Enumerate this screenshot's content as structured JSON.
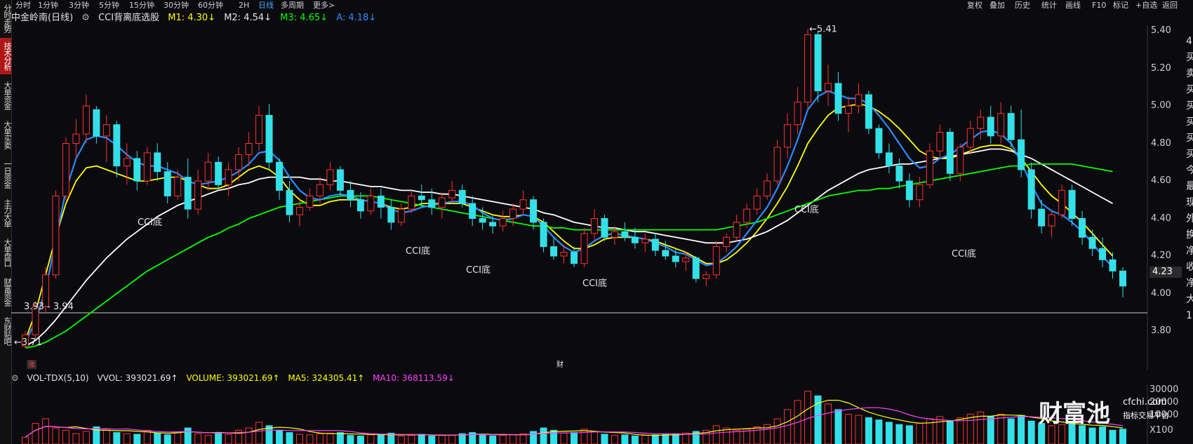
{
  "toolbar": {
    "periods": [
      "分时",
      "1分钟",
      "3分钟",
      "5分钟",
      "15分钟",
      "30分钟",
      "60分钟",
      "2H",
      "日线",
      "多周期",
      "更多>"
    ],
    "active_period": "日线",
    "right_tools": [
      "复权",
      "叠加",
      "历史",
      "统计",
      "画线",
      "F10",
      "标记",
      "+自选",
      "返回"
    ]
  },
  "left_tabs": [
    "分时走势",
    "技术分析",
    "大单资金",
    "大单买卖",
    "一日资金",
    "主力大单",
    "大单盘口",
    "财富资金",
    "东财贴吧"
  ],
  "active_left_tab": "技术分析",
  "title": {
    "stock": "中金岭南(日线)",
    "indicator": "CCI背离底选股",
    "m1": "M1: 4.30↓",
    "m2": "M2: 4.54↓",
    "m3": "M3: 4.65↓",
    "a": "A: 4.18↓"
  },
  "indicator_colors": {
    "m1": "#ffff00",
    "m2": "#ffffff",
    "m3": "#00ff00",
    "a": "#2a8cff",
    "up": "#ff3030",
    "down": "#33e0e8"
  },
  "price_axis": [
    "5.40",
    "5.20",
    "5.00",
    "4.80",
    "4.60",
    "4.40",
    "4.20",
    "4.00",
    "3.80"
  ],
  "current_price_label": "4.23",
  "annotations": {
    "high": "5.41",
    "low": "3.71",
    "support_range": "3.93 - 3.94",
    "cci_labels": [
      "CCI底",
      "CCI底",
      "CCI底",
      "CCI底",
      "CCI底",
      "CCI底"
    ],
    "zhang_badge": "涨",
    "cai_badge": "财"
  },
  "volume_header": {
    "name": "VOL-TDX(5,10)",
    "vvol": "VVOL: 393021.69↑",
    "volume": "VOLUME: 393021.69↑",
    "ma5": "MA5: 324305.41↑",
    "ma10": "MA10: 368113.59↓"
  },
  "volume_axis": [
    "30000",
    "20000",
    "10000",
    "X100"
  ],
  "right_side_text": [
    "4",
    "买",
    "卖",
    "买",
    "买",
    "买",
    "买",
    "买",
    "今",
    "最",
    "现",
    "外",
    "换",
    "净",
    "收",
    "净",
    "大",
    "1("
  ],
  "watermark": {
    "brand": "财富池",
    "site": "cfchi.com",
    "tagline": "指标交易平台"
  },
  "chart_data": {
    "type": "candlestick",
    "title": "中金岭南(日线)",
    "y_range": [
      3.7,
      5.45
    ],
    "high": 5.41,
    "low": 3.71,
    "last_close": 4.04,
    "ohlc": [
      [
        3.72,
        3.8,
        3.71,
        3.78
      ],
      [
        3.78,
        3.96,
        3.76,
        3.93
      ],
      [
        3.93,
        4.14,
        3.9,
        4.1
      ],
      [
        4.1,
        4.55,
        4.08,
        4.52
      ],
      [
        4.52,
        4.83,
        4.5,
        4.8
      ],
      [
        4.8,
        4.93,
        4.72,
        4.85
      ],
      [
        4.85,
        5.06,
        4.8,
        5.0
      ],
      [
        4.98,
        5.0,
        4.8,
        4.84
      ],
      [
        4.84,
        4.95,
        4.7,
        4.9
      ],
      [
        4.9,
        4.92,
        4.62,
        4.68
      ],
      [
        4.68,
        4.8,
        4.58,
        4.72
      ],
      [
        4.72,
        4.76,
        4.55,
        4.6
      ],
      [
        4.6,
        4.78,
        4.58,
        4.75
      ],
      [
        4.75,
        4.8,
        4.6,
        4.65
      ],
      [
        4.65,
        4.7,
        4.48,
        4.52
      ],
      [
        4.52,
        4.66,
        4.5,
        4.62
      ],
      [
        4.62,
        4.72,
        4.4,
        4.45
      ],
      [
        4.45,
        4.66,
        4.42,
        4.6
      ],
      [
        4.6,
        4.75,
        4.55,
        4.7
      ],
      [
        4.7,
        4.73,
        4.55,
        4.58
      ],
      [
        4.58,
        4.7,
        4.52,
        4.66
      ],
      [
        4.66,
        4.78,
        4.6,
        4.74
      ],
      [
        4.74,
        4.86,
        4.68,
        4.8
      ],
      [
        4.8,
        5.0,
        4.76,
        4.95
      ],
      [
        4.95,
        5.01,
        4.66,
        4.7
      ],
      [
        4.7,
        4.72,
        4.5,
        4.55
      ],
      [
        4.55,
        4.6,
        4.38,
        4.42
      ],
      [
        4.42,
        4.5,
        4.36,
        4.46
      ],
      [
        4.46,
        4.56,
        4.44,
        4.52
      ],
      [
        4.52,
        4.62,
        4.48,
        4.58
      ],
      [
        4.58,
        4.7,
        4.55,
        4.66
      ],
      [
        4.66,
        4.68,
        4.52,
        4.55
      ],
      [
        4.55,
        4.6,
        4.46,
        4.5
      ],
      [
        4.5,
        4.54,
        4.4,
        4.44
      ],
      [
        4.44,
        4.56,
        4.42,
        4.52
      ],
      [
        4.52,
        4.56,
        4.4,
        4.46
      ],
      [
        4.46,
        4.5,
        4.34,
        4.38
      ],
      [
        4.38,
        4.48,
        4.36,
        4.45
      ],
      [
        4.45,
        4.55,
        4.43,
        4.52
      ],
      [
        4.52,
        4.58,
        4.46,
        4.5
      ],
      [
        4.5,
        4.56,
        4.42,
        4.46
      ],
      [
        4.46,
        4.54,
        4.4,
        4.51
      ],
      [
        4.51,
        4.6,
        4.48,
        4.55
      ],
      [
        4.55,
        4.58,
        4.46,
        4.48
      ],
      [
        4.48,
        4.52,
        4.36,
        4.4
      ],
      [
        4.4,
        4.46,
        4.34,
        4.38
      ],
      [
        4.38,
        4.42,
        4.32,
        4.36
      ],
      [
        4.36,
        4.44,
        4.33,
        4.4
      ],
      [
        4.4,
        4.48,
        4.36,
        4.45
      ],
      [
        4.45,
        4.55,
        4.42,
        4.5
      ],
      [
        4.5,
        4.52,
        4.34,
        4.38
      ],
      [
        4.38,
        4.4,
        4.22,
        4.25
      ],
      [
        4.25,
        4.3,
        4.18,
        4.2
      ],
      [
        4.2,
        4.26,
        4.16,
        4.22
      ],
      [
        4.22,
        4.25,
        4.14,
        4.16
      ],
      [
        4.16,
        4.35,
        4.14,
        4.32
      ],
      [
        4.32,
        4.45,
        4.28,
        4.4
      ],
      [
        4.4,
        4.42,
        4.28,
        4.3
      ],
      [
        4.3,
        4.36,
        4.26,
        4.33
      ],
      [
        4.33,
        4.38,
        4.28,
        4.3
      ],
      [
        4.3,
        4.35,
        4.24,
        4.27
      ],
      [
        4.27,
        4.32,
        4.22,
        4.29
      ],
      [
        4.29,
        4.32,
        4.2,
        4.23
      ],
      [
        4.23,
        4.28,
        4.18,
        4.2
      ],
      [
        4.2,
        4.24,
        4.14,
        4.17
      ],
      [
        4.17,
        4.22,
        4.12,
        4.19
      ],
      [
        4.19,
        4.2,
        4.06,
        4.08
      ],
      [
        4.08,
        4.12,
        4.04,
        4.1
      ],
      [
        4.1,
        4.28,
        4.08,
        4.25
      ],
      [
        4.25,
        4.32,
        4.22,
        4.3
      ],
      [
        4.3,
        4.42,
        4.28,
        4.38
      ],
      [
        4.38,
        4.48,
        4.35,
        4.45
      ],
      [
        4.45,
        4.56,
        4.42,
        4.52
      ],
      [
        4.52,
        4.64,
        4.5,
        4.6
      ],
      [
        4.6,
        4.82,
        4.58,
        4.78
      ],
      [
        4.78,
        4.96,
        4.72,
        4.9
      ],
      [
        4.9,
        5.1,
        4.85,
        5.02
      ],
      [
        5.02,
        5.41,
        4.98,
        5.38
      ],
      [
        5.38,
        5.4,
        5.02,
        5.08
      ],
      [
        5.08,
        5.22,
        5.0,
        5.12
      ],
      [
        5.12,
        5.18,
        4.92,
        4.96
      ],
      [
        4.96,
        5.05,
        4.86,
        5.0
      ],
      [
        5.0,
        5.12,
        4.96,
        5.06
      ],
      [
        5.06,
        5.08,
        4.85,
        4.88
      ],
      [
        4.88,
        4.9,
        4.72,
        4.75
      ],
      [
        4.75,
        4.8,
        4.64,
        4.68
      ],
      [
        4.68,
        4.72,
        4.56,
        4.6
      ],
      [
        4.6,
        4.64,
        4.46,
        4.5
      ],
      [
        4.5,
        4.62,
        4.46,
        4.58
      ],
      [
        4.58,
        4.8,
        4.56,
        4.76
      ],
      [
        4.76,
        4.9,
        4.72,
        4.86
      ],
      [
        4.86,
        4.88,
        4.6,
        4.64
      ],
      [
        4.64,
        4.8,
        4.6,
        4.78
      ],
      [
        4.78,
        4.92,
        4.74,
        4.88
      ],
      [
        4.88,
        4.98,
        4.82,
        4.94
      ],
      [
        4.94,
        5.0,
        4.8,
        4.84
      ],
      [
        4.84,
        5.02,
        4.8,
        4.96
      ],
      [
        4.96,
        5.0,
        4.78,
        4.82
      ],
      [
        4.82,
        4.98,
        4.62,
        4.66
      ],
      [
        4.66,
        4.7,
        4.4,
        4.45
      ],
      [
        4.45,
        4.5,
        4.32,
        4.36
      ],
      [
        4.36,
        4.44,
        4.3,
        4.42
      ],
      [
        4.42,
        4.58,
        4.4,
        4.55
      ],
      [
        4.55,
        4.58,
        4.36,
        4.4
      ],
      [
        4.4,
        4.44,
        4.26,
        4.3
      ],
      [
        4.3,
        4.34,
        4.2,
        4.24
      ],
      [
        4.24,
        4.3,
        4.14,
        4.18
      ],
      [
        4.18,
        4.22,
        4.08,
        4.12
      ],
      [
        4.12,
        4.14,
        3.98,
        4.04
      ]
    ],
    "series": [
      {
        "name": "M1",
        "color": "#ffff00",
        "values": [
          3.75,
          3.9,
          4.1,
          4.3,
          4.48,
          4.6,
          4.67,
          4.68,
          4.66,
          4.64,
          4.62,
          4.6,
          4.6,
          4.61,
          4.62,
          4.62,
          4.6,
          4.58,
          4.56,
          4.56,
          4.58,
          4.62,
          4.66,
          4.68,
          4.66,
          4.62,
          4.55,
          4.5,
          4.47,
          4.47,
          4.49,
          4.5,
          4.5,
          4.5,
          4.49,
          4.48,
          4.46,
          4.45,
          4.46,
          4.48,
          4.48,
          4.48,
          4.48,
          4.48,
          4.46,
          4.44,
          4.42,
          4.41,
          4.41,
          4.42,
          4.41,
          4.38,
          4.33,
          4.28,
          4.24,
          4.24,
          4.26,
          4.29,
          4.3,
          4.3,
          4.3,
          4.29,
          4.28,
          4.26,
          4.24,
          4.22,
          4.19,
          4.16,
          4.16,
          4.18,
          4.22,
          4.27,
          4.33,
          4.4,
          4.48,
          4.57,
          4.68,
          4.8,
          4.88,
          4.95,
          4.99,
          5.0,
          5.01,
          5.0,
          4.97,
          4.93,
          4.88,
          4.82,
          4.76,
          4.73,
          4.72,
          4.72,
          4.74,
          4.76,
          4.78,
          4.79,
          4.79,
          4.77,
          4.72,
          4.65,
          4.58,
          4.52,
          4.48,
          4.43,
          4.38,
          4.32,
          4.26,
          4.2
        ]
      },
      {
        "name": "M2",
        "color": "#ffffff",
        "values": [
          3.72,
          3.75,
          3.8,
          3.86,
          3.93,
          4.0,
          4.07,
          4.13,
          4.19,
          4.24,
          4.29,
          4.33,
          4.37,
          4.41,
          4.44,
          4.47,
          4.49,
          4.51,
          4.53,
          4.55,
          4.56,
          4.58,
          4.59,
          4.61,
          4.62,
          4.62,
          4.62,
          4.62,
          4.61,
          4.61,
          4.6,
          4.6,
          4.59,
          4.58,
          4.57,
          4.57,
          4.56,
          4.55,
          4.55,
          4.54,
          4.54,
          4.53,
          4.53,
          4.52,
          4.51,
          4.5,
          4.49,
          4.48,
          4.47,
          4.46,
          4.45,
          4.43,
          4.42,
          4.4,
          4.38,
          4.37,
          4.36,
          4.35,
          4.35,
          4.34,
          4.33,
          4.33,
          4.32,
          4.31,
          4.3,
          4.29,
          4.28,
          4.27,
          4.27,
          4.27,
          4.28,
          4.29,
          4.31,
          4.33,
          4.36,
          4.39,
          4.43,
          4.47,
          4.51,
          4.55,
          4.58,
          4.61,
          4.64,
          4.66,
          4.67,
          4.68,
          4.69,
          4.69,
          4.7,
          4.71,
          4.72,
          4.73,
          4.74,
          4.75,
          4.76,
          4.77,
          4.77,
          4.76,
          4.74,
          4.72,
          4.69,
          4.66,
          4.63,
          4.6,
          4.57,
          4.54,
          4.51,
          4.48
        ]
      },
      {
        "name": "M3",
        "color": "#00ff00",
        "values": [
          3.71,
          3.72,
          3.74,
          3.77,
          3.8,
          3.84,
          3.88,
          3.92,
          3.96,
          4.0,
          4.04,
          4.08,
          4.12,
          4.15,
          4.18,
          4.21,
          4.24,
          4.27,
          4.3,
          4.32,
          4.35,
          4.37,
          4.4,
          4.42,
          4.44,
          4.46,
          4.47,
          4.48,
          4.49,
          4.5,
          4.51,
          4.52,
          4.52,
          4.52,
          4.52,
          4.51,
          4.5,
          4.49,
          4.48,
          4.47,
          4.46,
          4.45,
          4.44,
          4.43,
          4.42,
          4.41,
          4.4,
          4.39,
          4.38,
          4.37,
          4.36,
          4.36,
          4.35,
          4.35,
          4.34,
          4.34,
          4.34,
          4.34,
          4.34,
          4.34,
          4.34,
          4.34,
          4.34,
          4.34,
          4.34,
          4.34,
          4.34,
          4.34,
          4.34,
          4.35,
          4.36,
          4.37,
          4.38,
          4.4,
          4.42,
          4.44,
          4.46,
          4.48,
          4.5,
          4.52,
          4.53,
          4.54,
          4.55,
          4.55,
          4.56,
          4.56,
          4.57,
          4.58,
          4.59,
          4.6,
          4.61,
          4.62,
          4.63,
          4.64,
          4.65,
          4.66,
          4.67,
          4.68,
          4.68,
          4.69,
          4.69,
          4.69,
          4.69,
          4.69,
          4.68,
          4.67,
          4.66,
          4.65
        ]
      },
      {
        "name": "A",
        "color": "#2a8cff",
        "values": [
          3.74,
          3.85,
          4.02,
          4.28,
          4.55,
          4.72,
          4.82,
          4.84,
          4.83,
          4.79,
          4.74,
          4.7,
          4.68,
          4.68,
          4.66,
          4.64,
          4.6,
          4.58,
          4.59,
          4.6,
          4.62,
          4.65,
          4.69,
          4.75,
          4.76,
          4.71,
          4.62,
          4.55,
          4.51,
          4.5,
          4.52,
          4.53,
          4.52,
          4.5,
          4.49,
          4.48,
          4.45,
          4.43,
          4.44,
          4.46,
          4.47,
          4.48,
          4.49,
          4.49,
          4.47,
          4.43,
          4.4,
          4.39,
          4.4,
          4.42,
          4.41,
          4.36,
          4.3,
          4.25,
          4.22,
          4.24,
          4.28,
          4.31,
          4.32,
          4.31,
          4.3,
          4.29,
          4.27,
          4.25,
          4.22,
          4.21,
          4.18,
          4.15,
          4.16,
          4.2,
          4.25,
          4.32,
          4.39,
          4.46,
          4.56,
          4.68,
          4.82,
          4.98,
          5.05,
          5.08,
          5.06,
          5.04,
          5.04,
          5.01,
          4.95,
          4.88,
          4.8,
          4.72,
          4.67,
          4.68,
          4.72,
          4.74,
          4.78,
          4.82,
          4.86,
          4.87,
          4.85,
          4.8,
          4.7,
          4.58,
          4.48,
          4.44,
          4.42,
          4.38,
          4.33,
          4.27,
          4.2,
          4.14
        ]
      }
    ],
    "volume": [
      60,
      180,
      220,
      140,
      120,
      90,
      110,
      150,
      130,
      100,
      90,
      85,
      120,
      95,
      80,
      105,
      140,
      90,
      75,
      95,
      85,
      120,
      140,
      190,
      160,
      120,
      100,
      85,
      80,
      90,
      95,
      100,
      75,
      70,
      80,
      85,
      95,
      70,
      75,
      85,
      70,
      80,
      75,
      90,
      100,
      85,
      70,
      75,
      80,
      90,
      110,
      140,
      120,
      95,
      100,
      130,
      110,
      85,
      75,
      80,
      70,
      75,
      80,
      85,
      90,
      95,
      110,
      120,
      160,
      140,
      120,
      130,
      150,
      170,
      220,
      300,
      380,
      460,
      420,
      350,
      300,
      260,
      250,
      230,
      210,
      190,
      170,
      160,
      180,
      220,
      240,
      200,
      230,
      260,
      280,
      240,
      260,
      220,
      250,
      200,
      180,
      160,
      170,
      190,
      160,
      140,
      150,
      120,
      130
    ],
    "volume_axis": [
      30000,
      20000,
      10000
    ],
    "volume_unit": "X100"
  }
}
